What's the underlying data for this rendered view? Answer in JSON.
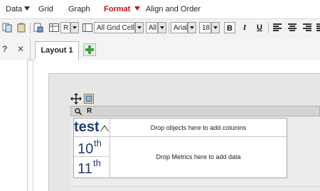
{
  "menu": {
    "items": [
      {
        "label": "Data",
        "has_dropdown": true
      },
      {
        "label": "Grid"
      },
      {
        "label": "Graph"
      },
      {
        "label": "Format",
        "active": true,
        "has_dropdown": true
      },
      {
        "label": "Align and Order"
      }
    ]
  },
  "toolbar": {
    "object_select": "R",
    "target_select": "All Grid Cells",
    "scope_select": "All",
    "font_family": "Arial",
    "font_size": "18",
    "bold_label": "B",
    "italic_label": "I",
    "underline_label": "U"
  },
  "tabs": {
    "help_label": "?",
    "close_label": "✕",
    "layout_tab": "Layout 1",
    "add_tab_icon": "plus-icon"
  },
  "grid": {
    "title": "R",
    "attribute_header": "test",
    "column_drop_text": "Drop objects here to add columns",
    "metric_drop_text": "Drop Metrics here to add data",
    "rows": [
      {
        "num": "10",
        "suffix": "th"
      },
      {
        "num": "11",
        "suffix": "th"
      }
    ]
  },
  "colors": {
    "active_menu": "#cc1111",
    "attribute_text": "#1f3d7a",
    "add_tab_green": "#3aa635"
  }
}
